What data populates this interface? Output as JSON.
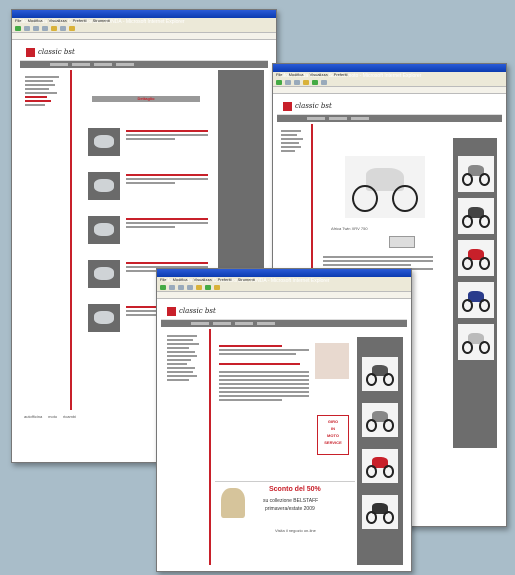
{
  "window_back": {
    "title": "Moto Honda Milano - Concessionario HONDA - Microsoft Internet Explorer",
    "menu": [
      "File",
      "Modifica",
      "Visualizza",
      "Preferiti",
      "Strumenti",
      "?"
    ],
    "site": {
      "logo_text": "classic bst",
      "section_heading": "Dettaglio",
      "footer_links": [
        "autofficina",
        "moto",
        "ricambi"
      ]
    }
  },
  "window_middle": {
    "title": "Moto Honda Milano - Scheda moto - Microsoft Internet Explorer",
    "menu": [
      "File",
      "Modifica",
      "Visualizza",
      "Preferiti",
      "Strumenti",
      "?"
    ],
    "site": {
      "logo_text": "classic bst",
      "product_caption": "Africa Twin XRV 750"
    }
  },
  "window_front": {
    "title": "Moto Honda Milano - Concessionario HONDA - Microsoft Internet Explorer",
    "menu": [
      "File",
      "Modifica",
      "Visualizza",
      "Preferiti",
      "Strumenti",
      "?"
    ],
    "site": {
      "logo_text": "classic bst",
      "promo_badge_lines": [
        "GIRO",
        "IN",
        "MOTO",
        "SERVICE"
      ],
      "promo_title": "Sconto del 50%",
      "promo_line1": "su collezione BELSTAFF",
      "promo_line2": "primavera/estate 2009",
      "promo_caption": "Visita il negozio on-line"
    }
  },
  "colors": {
    "brand_red": "#c8202a",
    "xp_blue": "#0b3bb0",
    "background": "#a9bdc9"
  }
}
